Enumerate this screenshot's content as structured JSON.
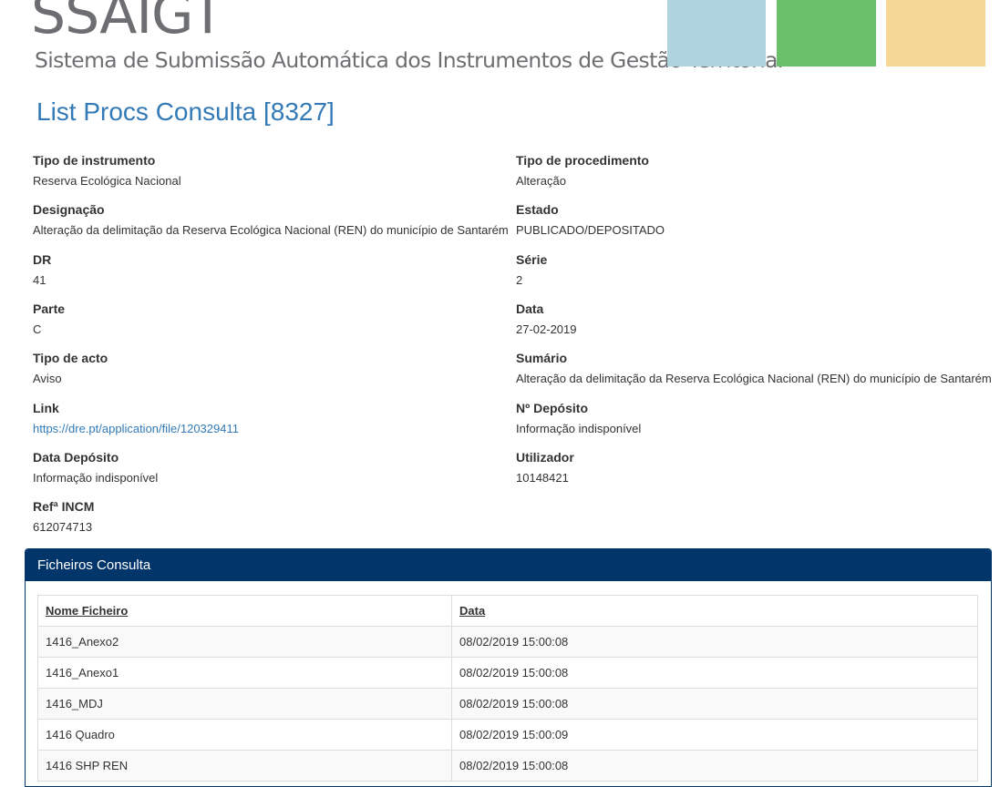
{
  "header": {
    "logo": "SSAIGT",
    "subtitle": "Sistema de  Submissão Automática dos Instrumentos de Gestão Territorial",
    "blocks": [
      "#aed3df",
      "#6abf69",
      "#f6d896"
    ]
  },
  "page": {
    "title": "List Procs Consulta [8327]"
  },
  "fields": {
    "tipo_instrumento": {
      "label": "Tipo de instrumento",
      "value": "Reserva Ecológica Nacional"
    },
    "tipo_procedimento": {
      "label": "Tipo de procedimento",
      "value": "Alteração"
    },
    "designacao": {
      "label": "Designação",
      "value": "Alteração da delimitação da Reserva Ecológica Nacional (REN) do município de Santarém"
    },
    "estado": {
      "label": "Estado",
      "value": "PUBLICADO/DEPOSITADO"
    },
    "dr": {
      "label": "DR",
      "value": "41"
    },
    "serie": {
      "label": "Série",
      "value": "2"
    },
    "parte": {
      "label": "Parte",
      "value": "C"
    },
    "data": {
      "label": "Data",
      "value": "27-02-2019"
    },
    "tipo_acto": {
      "label": "Tipo de acto",
      "value": "Aviso"
    },
    "sumario": {
      "label": "Sumário",
      "value": "Alteração da delimitação da Reserva Ecológica Nacional (REN) do município de Santarém"
    },
    "link": {
      "label": "Link",
      "value": "https://dre.pt/application/file/120329411"
    },
    "n_deposito": {
      "label": "Nº Depósito",
      "value": "Informação indisponível"
    },
    "data_deposito": {
      "label": "Data Depósito",
      "value": "Informação indisponível"
    },
    "utilizador": {
      "label": "Utilizador",
      "value": "10148421"
    },
    "ref_incm": {
      "label": "Refª INCM",
      "value": "612074713"
    }
  },
  "panel": {
    "title": "Ficheiros Consulta",
    "columns": [
      "Nome Ficheiro",
      "Data"
    ],
    "rows": [
      {
        "name": "1416_Anexo2",
        "date": "08/02/2019 15:00:08"
      },
      {
        "name": "1416_Anexo1",
        "date": "08/02/2019 15:00:08"
      },
      {
        "name": "1416_MDJ",
        "date": "08/02/2019 15:00:08"
      },
      {
        "name": "1416 Quadro",
        "date": "08/02/2019 15:00:09"
      },
      {
        "name": "1416 SHP REN",
        "date": "08/02/2019 15:00:08"
      }
    ]
  }
}
